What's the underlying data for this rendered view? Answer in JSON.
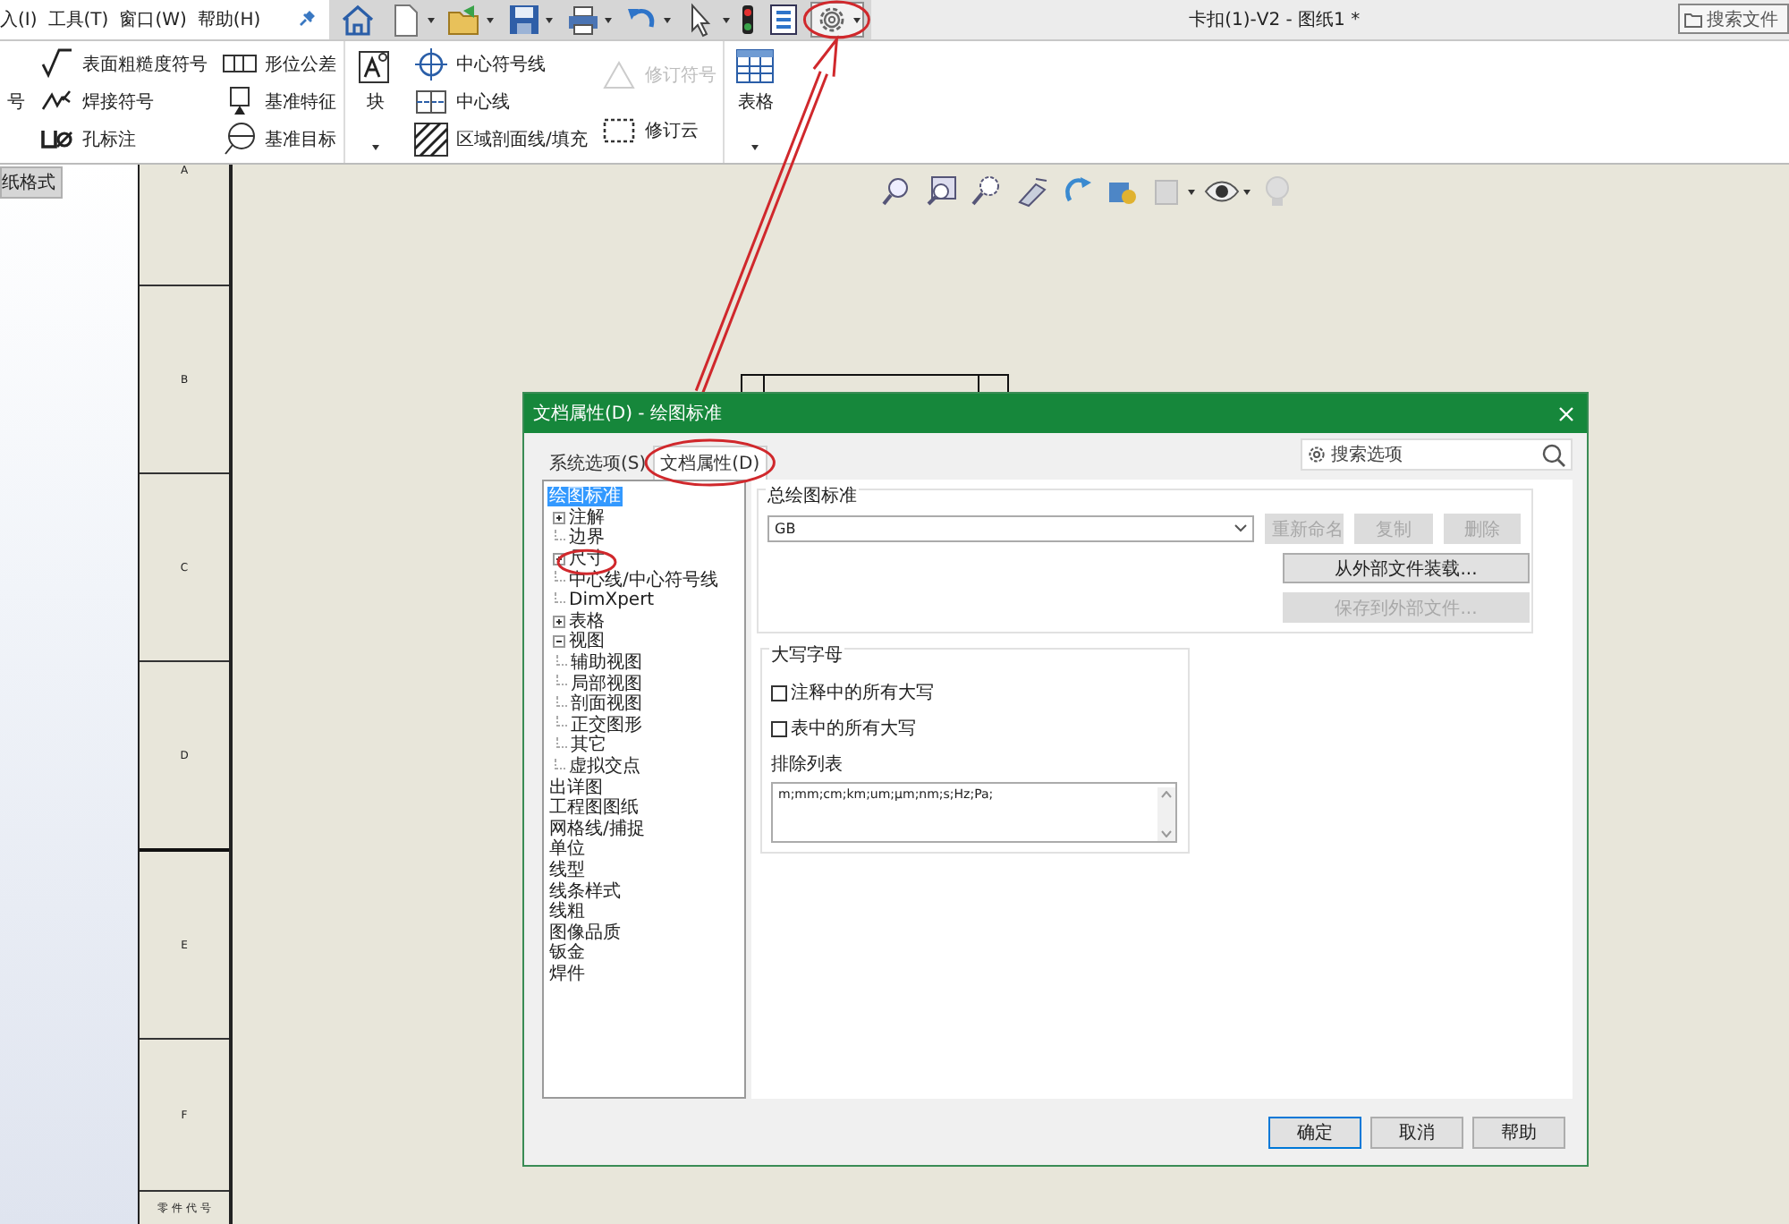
{
  "menu": [
    {
      "label": "入(I)"
    },
    {
      "label": "工具(T)"
    },
    {
      "label": "窗口(W)"
    },
    {
      "label": "帮助(H)"
    }
  ],
  "toolbar": [
    {
      "kind": "home",
      "dropdown": false,
      "highlighted": false
    },
    {
      "kind": "new",
      "dropdown": true,
      "highlighted": false
    },
    {
      "kind": "open",
      "dropdown": true,
      "highlighted": false
    },
    {
      "kind": "save",
      "dropdown": true,
      "highlighted": false
    },
    {
      "kind": "print",
      "dropdown": true,
      "highlighted": false
    },
    {
      "kind": "undo",
      "dropdown": true,
      "highlighted": false
    },
    {
      "kind": "select",
      "dropdown": true,
      "highlighted": false
    },
    {
      "kind": "rebuild",
      "dropdown": false,
      "highlighted": false
    },
    {
      "kind": "properties",
      "dropdown": false,
      "highlighted": false
    },
    {
      "kind": "options",
      "dropdown": true,
      "highlighted": true
    }
  ],
  "document_title": "卡扣(1)-V2 - 图纸1 *",
  "search": {
    "placeholder": "搜索文件"
  },
  "ribbon": [
    {
      "kind": "small",
      "items": [
        {
          "label": "号",
          "disabled": false
        }
      ]
    },
    {
      "kind": "small",
      "items": [
        {
          "label": "表面粗糙度符号",
          "disabled": false
        },
        {
          "label": "焊接符号",
          "disabled": false
        },
        {
          "label": "孔标注",
          "disabled": false
        }
      ]
    },
    {
      "kind": "small",
      "items": [
        {
          "label": "形位公差",
          "disabled": false
        },
        {
          "label": "基准特征",
          "disabled": false
        },
        {
          "label": "基准目标",
          "disabled": false
        }
      ]
    },
    {
      "kind": "large",
      "items": [
        {
          "label": "块",
          "disabled": false
        }
      ]
    },
    {
      "kind": "small",
      "items": [
        {
          "label": "中心符号线",
          "disabled": false
        },
        {
          "label": "中心线",
          "disabled": false
        },
        {
          "label": "区域剖面线/填充",
          "disabled": false
        }
      ]
    },
    {
      "kind": "small",
      "items": [
        {
          "label": "修订符号",
          "disabled": true
        },
        {
          "label": "修订云",
          "disabled": false
        }
      ]
    },
    {
      "kind": "large",
      "items": [
        {
          "label": "表格",
          "disabled": false
        }
      ]
    }
  ],
  "view_toolbar": [
    {
      "kind": "zoom",
      "dropdown": false
    },
    {
      "kind": "zoom-fit",
      "dropdown": false
    },
    {
      "kind": "zoom-area",
      "dropdown": false
    },
    {
      "kind": "section",
      "dropdown": false
    },
    {
      "kind": "rotate",
      "dropdown": false
    },
    {
      "kind": "display",
      "dropdown": false
    },
    {
      "kind": "hide",
      "dropdown": true
    },
    {
      "kind": "eye",
      "dropdown": true
    },
    {
      "kind": "light",
      "dropdown": false
    }
  ],
  "left_panel": {
    "tab": "纸格式"
  },
  "sheet": {
    "zones": [
      "A",
      "B",
      "C",
      "D",
      "E",
      "F"
    ],
    "footer": "零 件 代 号"
  },
  "dialog": {
    "title": "文档属性(D) - 绘图标准",
    "tabs": [
      {
        "label": "系统选项(S)",
        "selected": false
      },
      {
        "label": "文档属性(D)",
        "selected": true
      }
    ],
    "search": {
      "placeholder": "搜索选项"
    },
    "tree": [
      {
        "label": "绘图标准",
        "selected": true,
        "children": [
          {
            "label": "注解",
            "selected": false,
            "expanded": false
          },
          {
            "label": "边界",
            "selected": false
          },
          {
            "label": "尺寸",
            "selected": false,
            "expanded": false
          },
          {
            "label": "中心线/中心符号线",
            "selected": false
          },
          {
            "label": "DimXpert",
            "selected": false
          },
          {
            "label": "表格",
            "selected": false,
            "expanded": false
          },
          {
            "label": "视图",
            "selected": false,
            "expanded": true,
            "children": [
              {
                "label": "辅助视图",
                "selected": false
              },
              {
                "label": "局部视图",
                "selected": false
              },
              {
                "label": "剖面视图",
                "selected": false
              },
              {
                "label": "正交图形",
                "selected": false
              },
              {
                "label": "其它",
                "selected": false
              }
            ]
          },
          {
            "label": "虚拟交点",
            "selected": false
          }
        ]
      },
      {
        "label": "出详图",
        "selected": false
      },
      {
        "label": "工程图图纸",
        "selected": false
      },
      {
        "label": "网格线/捕捉",
        "selected": false
      },
      {
        "label": "单位",
        "selected": false
      },
      {
        "label": "线型",
        "selected": false
      },
      {
        "label": "线条样式",
        "selected": false
      },
      {
        "label": "线粗",
        "selected": false
      },
      {
        "label": "图像品质",
        "selected": false
      },
      {
        "label": "钣金",
        "selected": false
      },
      {
        "label": "焊件",
        "selected": false
      }
    ],
    "standard": {
      "title": "总绘图标准",
      "value": "GB",
      "buttons": [
        {
          "label": "重新命名",
          "disabled": true
        },
        {
          "label": "复制",
          "disabled": true
        },
        {
          "label": "删除",
          "disabled": true
        },
        {
          "label": "从外部文件装载...",
          "disabled": false
        },
        {
          "label": "保存到外部文件...",
          "disabled": true
        }
      ]
    },
    "uppercase": {
      "title": "大写字母",
      "options": [
        {
          "label": "注释中的所有大写",
          "checked": false
        },
        {
          "label": "表中的所有大写",
          "checked": false
        }
      ],
      "exclusion_label": "排除列表",
      "exclusion_value": "m;mm;cm;km;um;μm;nm;s;Hz;Pa;"
    },
    "buttons": [
      {
        "label": "确定",
        "default": true
      },
      {
        "label": "取消",
        "default": false
      },
      {
        "label": "帮助",
        "default": false
      }
    ]
  },
  "annotations": [
    {
      "kind": "arrow"
    },
    {
      "kind": "ellipse"
    },
    {
      "kind": "ellipse"
    },
    {
      "kind": "ellipse"
    }
  ]
}
